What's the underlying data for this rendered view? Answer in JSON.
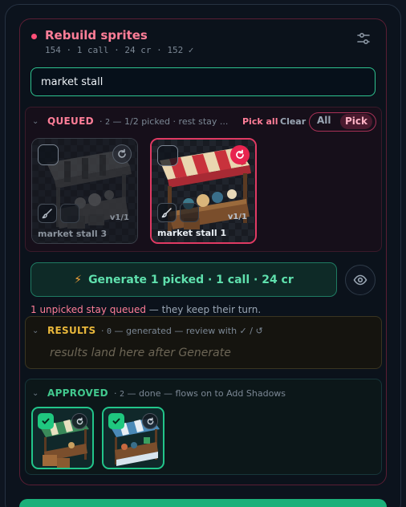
{
  "header": {
    "title": "Rebuild sprites",
    "subtitle": "154 · 1 call · 24 cr · 152 ✓",
    "status_color": "#ff4f78",
    "settings_icon": "sliders-icon"
  },
  "search": {
    "value": "market stall"
  },
  "queued": {
    "title": "QUEUED",
    "count": "2",
    "meta": "— 1/2 picked · rest stay ...",
    "pick_all": "Pick all",
    "clear": "Clear",
    "filter_all": "All",
    "filter_pick": "Pick",
    "cards": [
      {
        "name": "market stall 3",
        "version": "v1/1",
        "picked": false
      },
      {
        "name": "market stall 1",
        "version": "v1/1",
        "picked": true
      }
    ]
  },
  "generate": {
    "label": "Generate 1 picked · 1 call · 24 cr",
    "icon": "bolt-icon",
    "preview_icon": "eye-icon"
  },
  "queue_note": {
    "highlight": "1 unpicked stay queued",
    "rest": " — they keep their turn."
  },
  "results": {
    "title": "RESULTS",
    "count": "0",
    "meta": "— generated — review with ✓ / ↺",
    "placeholder": "results land here after Generate"
  },
  "approved": {
    "title": "APPROVED",
    "count": "2",
    "meta": "— done — flows on to Add Shadows"
  },
  "colors": {
    "accent_pink": "#ff7e98",
    "accent_green": "#22c58a",
    "accent_gold": "#e8b73b"
  }
}
